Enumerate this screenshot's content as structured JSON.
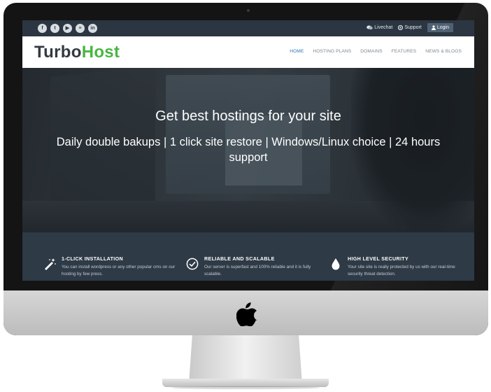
{
  "topbar": {
    "social_icons": [
      {
        "name": "facebook-icon",
        "glyph": "f"
      },
      {
        "name": "twitter-icon",
        "glyph": "t"
      },
      {
        "name": "youtube-icon",
        "glyph": "▶"
      },
      {
        "name": "stackexchange-icon",
        "glyph": "≡"
      },
      {
        "name": "linkedin-icon",
        "glyph": "in"
      }
    ],
    "livechat_label": "Livechat",
    "support_label": "Support",
    "login_label": "Login"
  },
  "navbar": {
    "logo_part1": "Turbo",
    "logo_part2": "Host",
    "menu": [
      "HOME",
      "HOSTING PLANS",
      "DOMAINS",
      "FEATURES",
      "NEWS & BLOGS"
    ],
    "active_index": 0
  },
  "hero": {
    "title": "Get best hostings for your site",
    "subtitle": "Daily double bakups | 1 click site restore | Windows/Linux choice | 24 hours support"
  },
  "features": [
    {
      "icon": "magic-wand-icon",
      "title": "1-CLICK INSTALLATION",
      "text": "You can install wordpress or any other popular cms on our hosting by few press."
    },
    {
      "icon": "check-circle-icon",
      "title": "RELIABLE AND SCALABLE",
      "text": "Our server is superfast and 100% reliable and it is fully scalable."
    },
    {
      "icon": "drop-icon",
      "title": "HIGH LEVEL SECURITY",
      "text": "Your site site is really protected by us with our real-time security threat detection."
    }
  ],
  "colors": {
    "brand_green": "#4bb543",
    "active_link": "#2f75b5",
    "dark_bar": "#2c3642",
    "features_bg": "#2e3a46"
  }
}
